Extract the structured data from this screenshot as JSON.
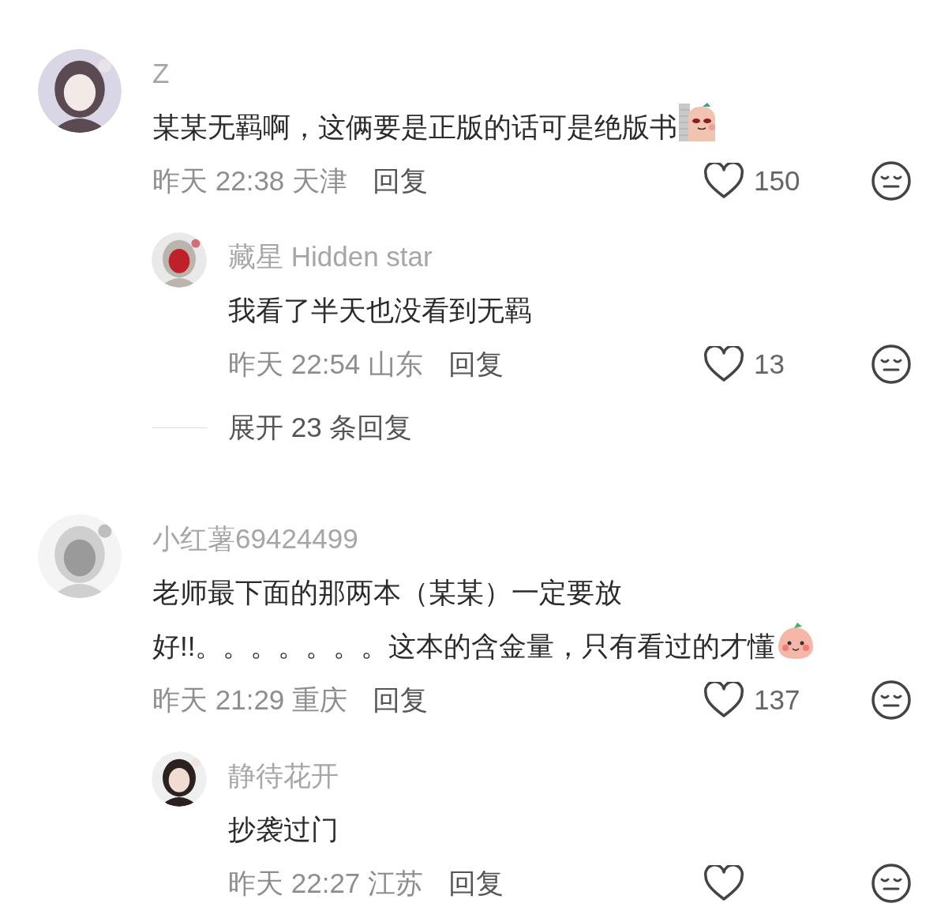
{
  "comments": [
    {
      "name": "Z",
      "avatar": {
        "kind": "picture"
      },
      "text_lines": [
        "某某无羁啊，这俩要是正版的话可是绝版书"
      ],
      "sticker": {
        "kind": "wall-peek"
      },
      "meta": "昨天 22:38 天津",
      "reply_label": "回复",
      "liked": false,
      "likes": "150",
      "replies": [
        {
          "name": "藏星 Hidden star",
          "avatar": {
            "kind": "picture"
          },
          "text_lines": [
            "我看了半天也没看到无羁"
          ],
          "meta": "昨天 22:54 山东",
          "reply_label": "回复",
          "liked": false,
          "likes": "13"
        }
      ],
      "expand": "展开 23 条回复"
    },
    {
      "name": "小红薯69424499",
      "avatar": {
        "kind": "picture"
      },
      "text_lines": [
        "老师最下面的那两本（某某）一定要放",
        "好!!。。。。。。。这本的含金量，只有看过的才懂"
      ],
      "sticker": {
        "kind": "peach"
      },
      "meta": "昨天 21:29 重庆",
      "reply_label": "回复",
      "liked": false,
      "likes": "137",
      "replies": [
        {
          "name": "静待花开",
          "avatar": {
            "kind": "picture"
          },
          "text_lines": [
            "抄袭过门"
          ],
          "meta": "昨天 22:27 江苏",
          "reply_label": "回复",
          "liked": false
        }
      ]
    }
  ]
}
